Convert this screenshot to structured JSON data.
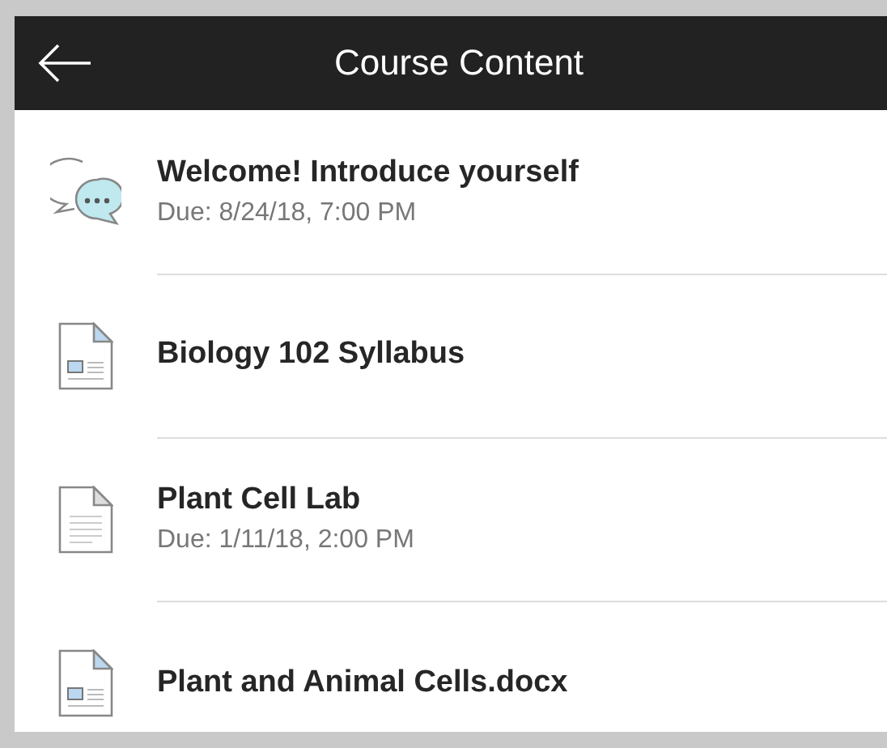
{
  "header": {
    "title": "Course Content"
  },
  "items": [
    {
      "kind": "discussion",
      "title": "Welcome! Introduce yourself",
      "due": "Due: 8/24/18, 7:00 PM"
    },
    {
      "kind": "document",
      "title": "Biology 102 Syllabus"
    },
    {
      "kind": "file",
      "title": "Plant Cell Lab",
      "due": "Due: 1/11/18, 2:00 PM"
    },
    {
      "kind": "document",
      "title": "Plant and Animal Cells.docx"
    }
  ]
}
